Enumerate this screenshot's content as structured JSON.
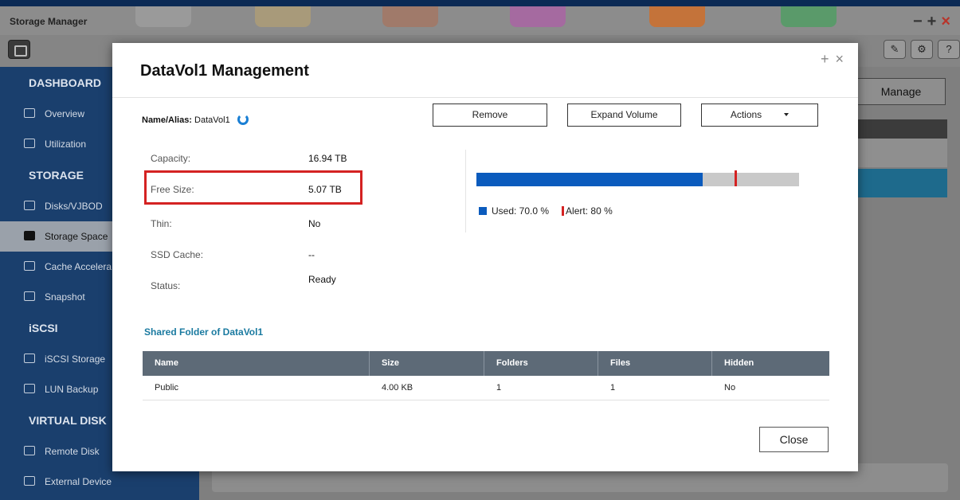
{
  "app": {
    "title": "Storage Manager"
  },
  "sidebar": {
    "sections": [
      {
        "heading": "DASHBOARD",
        "items": [
          {
            "label": "Overview"
          },
          {
            "label": "Utilization"
          }
        ]
      },
      {
        "heading": "STORAGE",
        "items": [
          {
            "label": "Disks/VJBOD"
          },
          {
            "label": "Storage Space"
          },
          {
            "label": "Cache Accelera"
          },
          {
            "label": "Snapshot"
          }
        ]
      },
      {
        "heading": "iSCSI",
        "items": [
          {
            "label": "iSCSI Storage"
          },
          {
            "label": "LUN Backup"
          }
        ]
      },
      {
        "heading": "VIRTUAL DISK",
        "items": [
          {
            "label": "Remote Disk"
          },
          {
            "label": "External Device"
          }
        ]
      }
    ]
  },
  "background": {
    "manage_label": "Manage"
  },
  "dialog": {
    "title": "DataVol1 Management",
    "name_label": "Name/Alias:",
    "name_value": "DataVol1",
    "buttons": {
      "remove": "Remove",
      "expand": "Expand Volume",
      "actions": "Actions"
    },
    "info": [
      {
        "label": "Capacity:",
        "value": "16.94 TB"
      },
      {
        "label": "Free Size:",
        "value": "5.07 TB"
      },
      {
        "label": "Thin:",
        "value": "No"
      },
      {
        "label": "SSD Cache:",
        "value": "--"
      },
      {
        "label": "Status:",
        "value": "Ready"
      }
    ],
    "usage": {
      "used_percent": 70.0,
      "alert_percent": 80,
      "used_label": "Used: 70.0 %",
      "alert_label": "Alert: 80 %"
    },
    "shared_title": "Shared Folder of DataVol1",
    "table": {
      "columns": [
        "Name",
        "Size",
        "Folders",
        "Files",
        "Hidden"
      ],
      "rows": [
        [
          "Public",
          "4.00 KB",
          "1",
          "1",
          "No"
        ]
      ]
    },
    "close_label": "Close"
  },
  "colors": {
    "used": "#0b5bbd",
    "alert": "#d42222",
    "sidebar": "#1a3f6d",
    "table_header": "#5d6a77"
  }
}
